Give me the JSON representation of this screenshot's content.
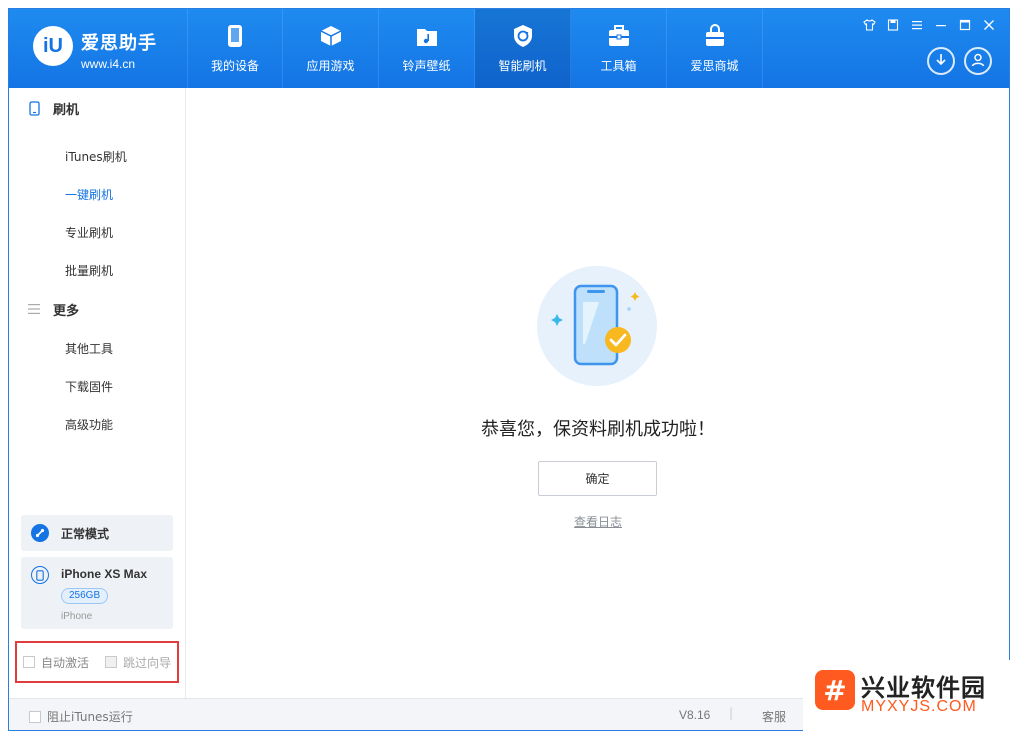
{
  "app": {
    "logo_name": "爱思助手",
    "logo_url": "www.i4.cn",
    "logo_glyph": "iU"
  },
  "nav": {
    "items": [
      {
        "label": "我的设备",
        "icon": "phone-icon"
      },
      {
        "label": "应用游戏",
        "icon": "cube-icon"
      },
      {
        "label": "铃声壁纸",
        "icon": "music-folder-icon"
      },
      {
        "label": "智能刷机",
        "icon": "refresh-shield-icon"
      },
      {
        "label": "工具箱",
        "icon": "toolbox-icon"
      },
      {
        "label": "爱思商城",
        "icon": "shopping-bag-icon"
      }
    ],
    "active_index": 3
  },
  "window_controls": [
    "shirt-icon",
    "note-icon",
    "menu-icon",
    "minimize-icon",
    "maximize-icon",
    "close-icon"
  ],
  "sidebar": {
    "group1_title": "刷机",
    "group1_items": [
      "iTunes刷机",
      "一键刷机",
      "专业刷机",
      "批量刷机"
    ],
    "group1_active": 1,
    "group2_title": "更多",
    "group2_items": [
      "其他工具",
      "下载固件",
      "高级功能"
    ],
    "mode_label": "正常模式",
    "device_name": "iPhone XS Max",
    "device_capacity": "256GB",
    "device_type": "iPhone",
    "auto_activate_label": "自动激活",
    "skip_guide_label": "跳过向导"
  },
  "main": {
    "success_message": "恭喜您，保资料刷机成功啦！",
    "confirm_label": "确定",
    "view_log_label": "查看日志"
  },
  "statusbar": {
    "block_itunes_label": "阻止iTunes运行",
    "version": "V8.16",
    "separator": "|",
    "customer_service": "客服"
  },
  "watermark": {
    "title": "兴业软件园",
    "subtitle": "MYXYJS.COM",
    "glyph": "#"
  },
  "colors": {
    "header_blue": "#1474e4",
    "accent_blue": "#1474e4",
    "highlight_red": "#e23b3b",
    "watermark_orange": "#ff5a1f"
  }
}
